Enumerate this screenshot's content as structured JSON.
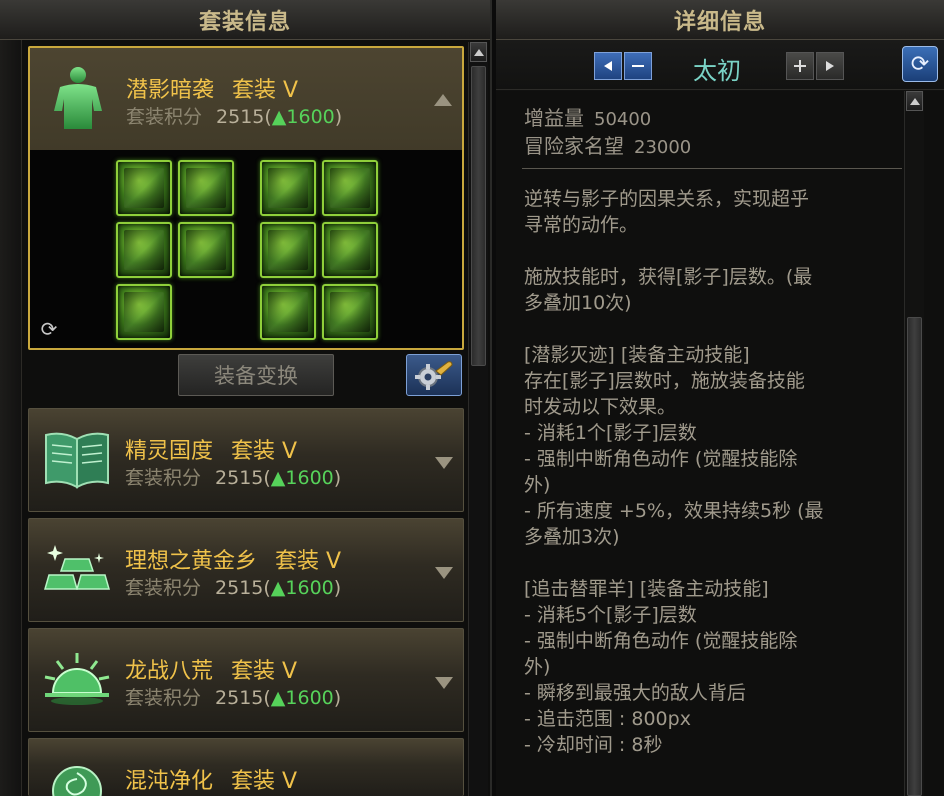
{
  "left_panel": {
    "title": "套装信息",
    "change_button_label": "装备变换",
    "sets": [
      {
        "name": "潜影暗袭",
        "tier": "套装 V",
        "score_label": "套装积分",
        "score": "2515(",
        "delta": "▲1600",
        "score_close": ")",
        "icon": "body-armor-icon",
        "expanded": true
      },
      {
        "name": "精灵国度",
        "tier": "套装 V",
        "score_label": "套装积分",
        "score": "2515(",
        "delta": "▲1600",
        "score_close": ")",
        "icon": "open-book-icon",
        "expanded": false
      },
      {
        "name": "理想之黄金乡",
        "tier": "套装 V",
        "score_label": "套装积分",
        "score": "2515(",
        "delta": "▲1600",
        "score_close": ")",
        "icon": "gold-bars-icon",
        "expanded": false
      },
      {
        "name": "龙战八荒",
        "tier": "套装 V",
        "score_label": "套装积分",
        "score": "2515(",
        "delta": "▲1600",
        "score_close": ")",
        "icon": "rising-sun-icon",
        "expanded": false
      },
      {
        "name": "混沌净化",
        "tier": "套装 V",
        "icon": "rose-icon",
        "expanded": false
      }
    ]
  },
  "right_panel": {
    "title": "详细信息",
    "nav_title": "太初",
    "stats": [
      {
        "label": "增益量",
        "value": "50400"
      },
      {
        "label": "冒险家名望",
        "value": "23000"
      }
    ],
    "description": "逆转与影子的因果关系，实现超乎\n寻常的动作。\n\n施放技能时，获得[影子]层数。(最\n多叠加10次)\n\n[潜影灭迹] [装备主动技能]\n存在[影子]层数时，施放装备技能\n时发动以下效果。\n- 消耗1个[影子]层数\n- 强制中断角色动作 (觉醒技能除\n外)\n- 所有速度 +5%，效果持续5秒 (最\n多叠加3次)\n\n[追击替罪羊] [装备主动技能]\n- 消耗5个[影子]层数\n- 强制中断角色动作 (觉醒技能除\n外)\n- 瞬移到最强大的敌人背后\n- 追击范围 : 800px\n- 冷却时间 : 8秒"
  },
  "colors": {
    "set_name": "#f0c24a",
    "delta_green": "#56d25a",
    "active_border": "#c9a83d",
    "nav_title": "#7ad3c6"
  }
}
